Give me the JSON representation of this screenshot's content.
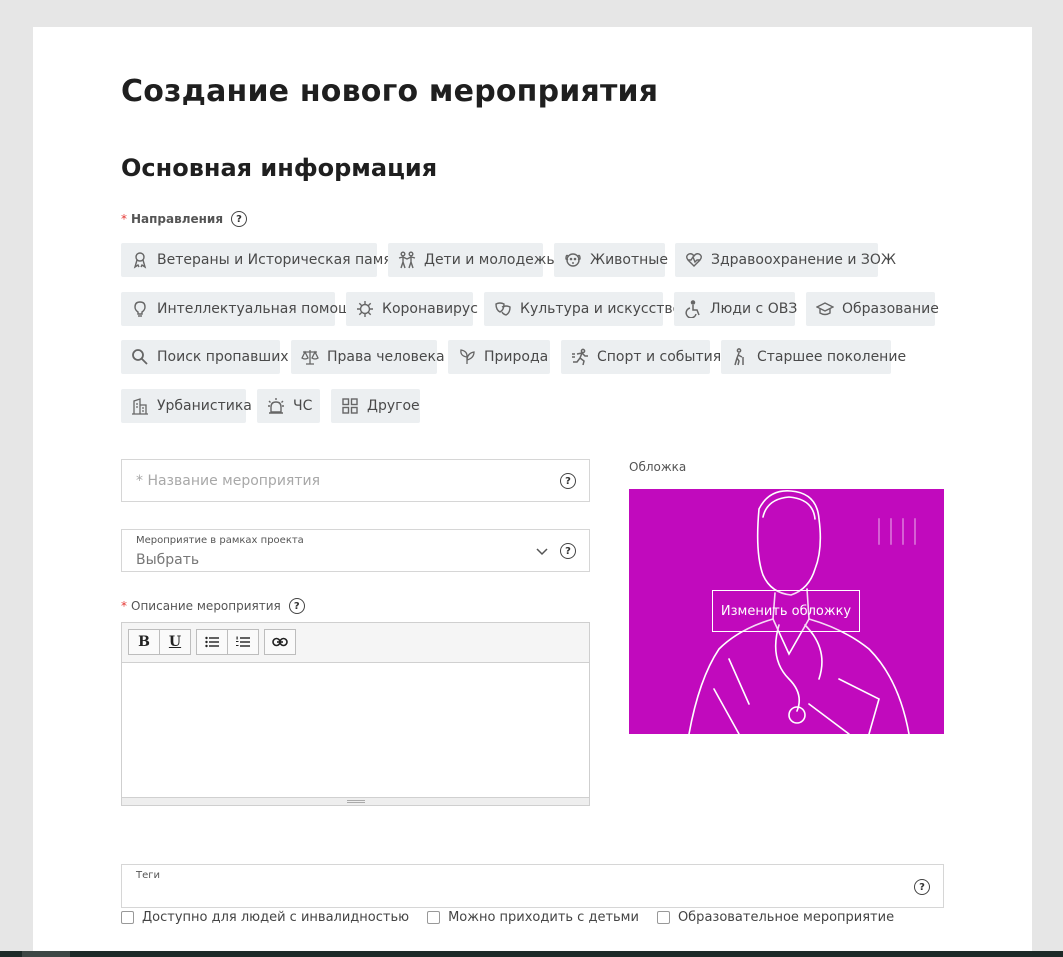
{
  "page": {
    "title": "Создание нового мероприятия",
    "section_title": "Основная информация"
  },
  "directions": {
    "required_mark": "*",
    "label": "Направления",
    "help": "?",
    "items": [
      {
        "label": "Ветераны и Историческая память",
        "icon": "ribbon-icon"
      },
      {
        "label": "Дети и молодежь",
        "icon": "children-icon"
      },
      {
        "label": "Животные",
        "icon": "dog-icon"
      },
      {
        "label": "Здравоохранение и ЗОЖ",
        "icon": "heart-pulse-icon"
      },
      {
        "label": "Интеллектуальная помощь",
        "icon": "lightbulb-icon"
      },
      {
        "label": "Коронавирус",
        "icon": "virus-icon"
      },
      {
        "label": "Культура и искусство",
        "icon": "masks-icon"
      },
      {
        "label": "Люди с ОВЗ",
        "icon": "wheelchair-icon"
      },
      {
        "label": "Образование",
        "icon": "graduation-cap-icon"
      },
      {
        "label": "Поиск пропавших",
        "icon": "search-icon"
      },
      {
        "label": "Права человека",
        "icon": "scales-icon"
      },
      {
        "label": "Природа",
        "icon": "leaf-icon"
      },
      {
        "label": "Спорт и события",
        "icon": "runner-icon"
      },
      {
        "label": "Старшее поколение",
        "icon": "elder-icon"
      },
      {
        "label": "Урбанистика",
        "icon": "buildings-icon"
      },
      {
        "label": "ЧС",
        "icon": "siren-icon"
      },
      {
        "label": "Другое",
        "icon": "grid-icon"
      }
    ]
  },
  "event_name": {
    "placeholder": "* Название мероприятия",
    "help": "?"
  },
  "project": {
    "label": "Мероприятие в рамках проекта",
    "value": "Выбрать",
    "help": "?"
  },
  "description": {
    "required_mark": "*",
    "label": "Описание мероприятия",
    "help": "?",
    "toolbar": {
      "bold": "B",
      "underline": "U"
    }
  },
  "cover": {
    "label": "Обложка",
    "button": "Изменить обложку",
    "bg_color": "#c10abd"
  },
  "tags": {
    "label": "Теги",
    "help": "?"
  },
  "checkboxes": [
    {
      "label": "Доступно для людей с инвалидностью",
      "checked": false
    },
    {
      "label": "Можно приходить с детьми",
      "checked": false
    },
    {
      "label": "Образовательное мероприятие",
      "checked": false
    }
  ]
}
